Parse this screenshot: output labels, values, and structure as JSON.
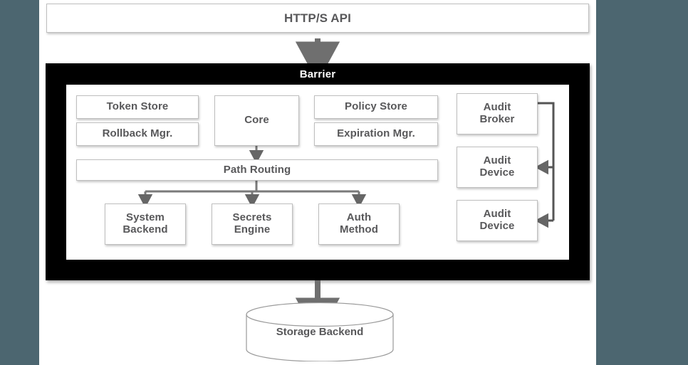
{
  "page": {
    "background_color": "#4c6670",
    "canvas_color": "#ffffff",
    "accent_color": "#6b6b6b",
    "text_color": "#58585a",
    "barrier_color": "#000000"
  },
  "api": {
    "label": "HTTP/S API"
  },
  "barrier": {
    "title": "Barrier",
    "components": {
      "token_store": "Token Store",
      "rollback_mgr": "Rollback Mgr.",
      "core": "Core",
      "policy_store": "Policy Store",
      "expiration_mgr": "Expiration Mgr.",
      "path_routing": "Path Routing",
      "system_backend": "System\nBackend",
      "system_backend_line1": "System",
      "system_backend_line2": "Backend",
      "secrets_engine_line1": "Secrets",
      "secrets_engine_line2": "Engine",
      "auth_method_line1": "Auth",
      "auth_method_line2": "Method",
      "audit_broker_line1": "Audit",
      "audit_broker_line2": "Broker",
      "audit_device_1_line1": "Audit",
      "audit_device_1_line2": "Device",
      "audit_device_2_line1": "Audit",
      "audit_device_2_line2": "Device"
    }
  },
  "storage": {
    "label": "Storage Backend"
  },
  "connectors": [
    {
      "name": "api-to-barrier",
      "from": "HTTP/S API",
      "to": "Barrier",
      "direction": "down"
    },
    {
      "name": "core-to-path-routing",
      "from": "Core",
      "to": "Path Routing",
      "direction": "down"
    },
    {
      "name": "path-routing-to-system-backend",
      "from": "Path Routing",
      "to": "System Backend",
      "direction": "down"
    },
    {
      "name": "path-routing-to-secrets-engine",
      "from": "Path Routing",
      "to": "Secrets Engine",
      "direction": "down"
    },
    {
      "name": "path-routing-to-auth-method",
      "from": "Path Routing",
      "to": "Auth Method",
      "direction": "down"
    },
    {
      "name": "audit-broker-to-audit-device-1",
      "from": "Audit Broker",
      "to": "Audit Device",
      "direction": "left"
    },
    {
      "name": "audit-broker-to-audit-device-2",
      "from": "Audit Broker",
      "to": "Audit Device",
      "direction": "left"
    },
    {
      "name": "barrier-to-storage",
      "from": "Barrier",
      "to": "Storage Backend",
      "direction": "down"
    }
  ]
}
